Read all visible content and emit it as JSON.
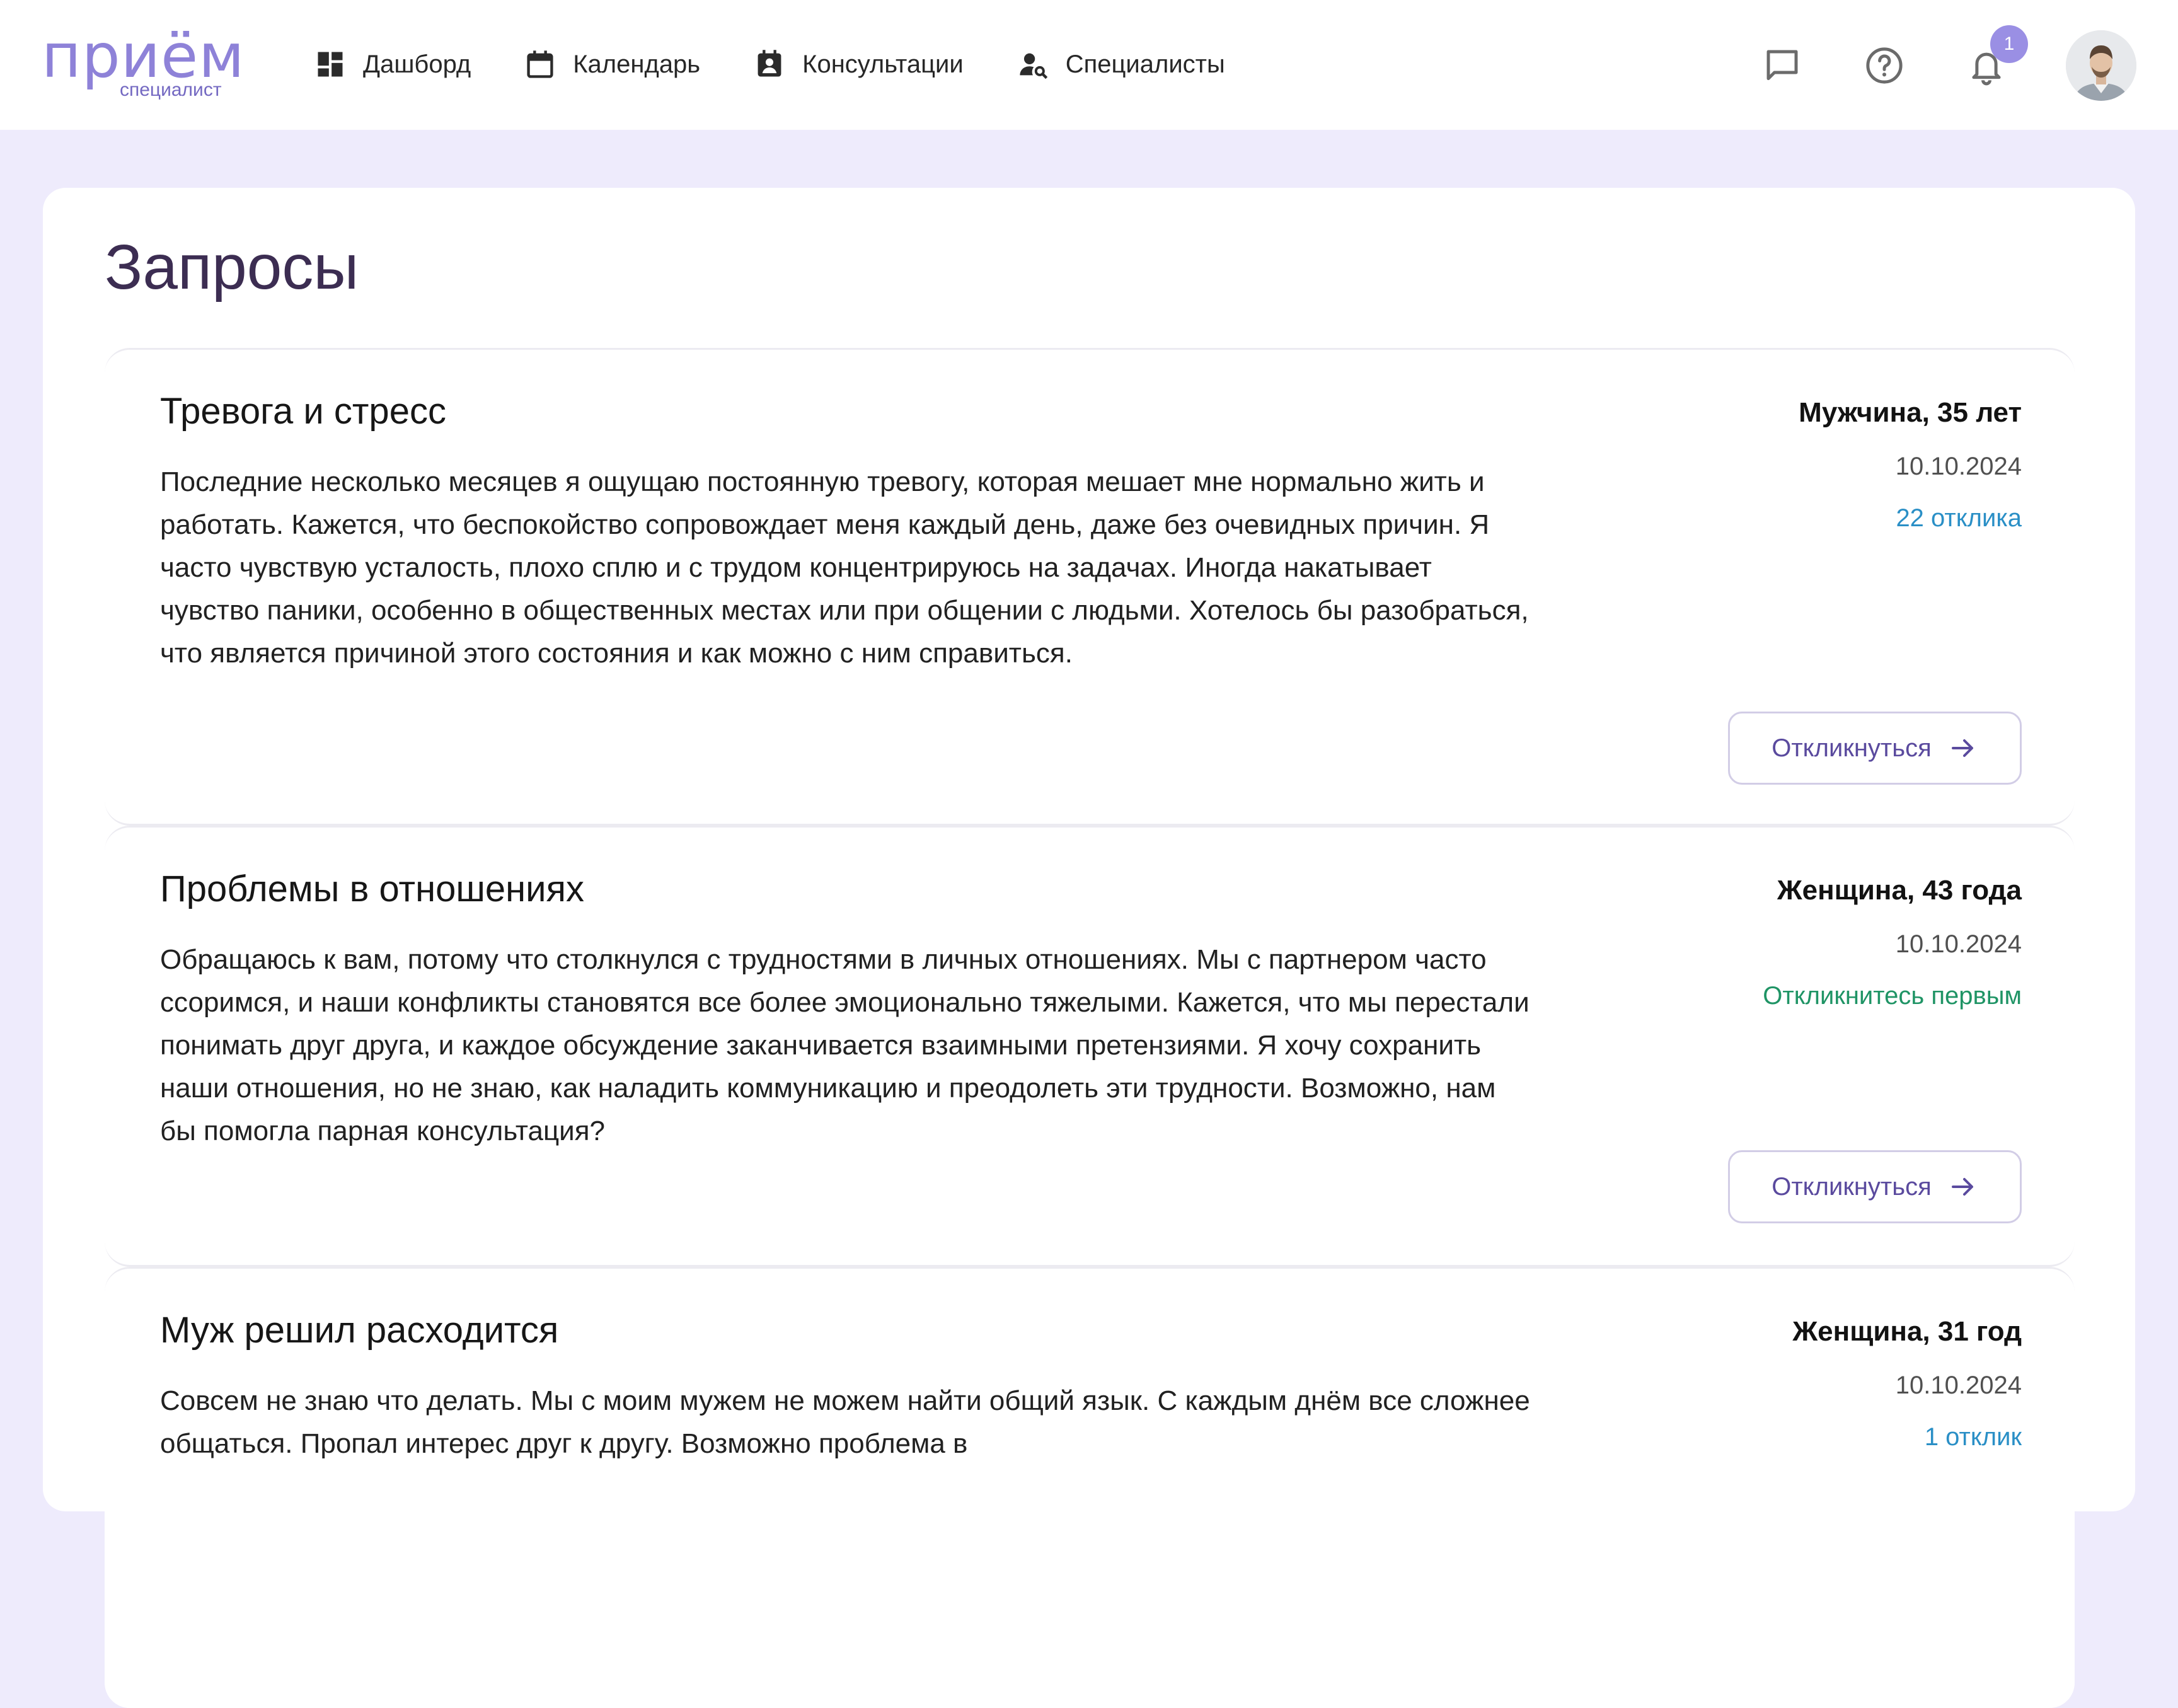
{
  "brand": {
    "logo_main": "приём",
    "logo_sub": "специалист"
  },
  "nav": {
    "items": [
      {
        "label": "Дашборд",
        "icon": "dashboard-icon"
      },
      {
        "label": "Календарь",
        "icon": "calendar-icon"
      },
      {
        "label": "Консультации",
        "icon": "consultations-icon"
      },
      {
        "label": "Специалисты",
        "icon": "specialists-icon"
      }
    ]
  },
  "header": {
    "notifications_count": "1",
    "icons": [
      "chat-icon",
      "help-icon",
      "bell-icon"
    ]
  },
  "page": {
    "title": "Запросы"
  },
  "requests": [
    {
      "title": "Тревога и стресс",
      "text": "Последние несколько месяцев я ощущаю постоянную тревогу, которая мешает мне нормально жить и работать. Кажется, что беспокойство сопровождает меня каждый день, даже без очевидных причин. Я часто чувствую усталость, плохо сплю и с трудом концентрируюсь на задачах. Иногда накатывает чувство паники, особенно в общественных местах или при общении с людьми. Хотелось бы разобраться, что является причиной этого состояния и как можно с ним справиться.",
      "who": "Мужчина, 35 лет",
      "date": "10.10.2024",
      "responses": "22 отклика",
      "responses_color": "#2a8fc6",
      "button": "Откликнуться"
    },
    {
      "title": "Проблемы в отношениях",
      "text": "Обращаюсь к вам, потому что столкнулся с трудностями в личных отношениях. Мы с партнером часто ссоримся, и наши конфликты становятся все более эмоционально тяжелыми. Кажется, что мы перестали понимать друг друга, и каждое обсуждение заканчивается взаимными претензиями. Я хочу сохранить наши отношения, но не знаю, как наладить коммуникацию и преодолеть эти трудности. Возможно, нам бы помогла парная консультация?",
      "who": "Женщина, 43 года",
      "date": "10.10.2024",
      "responses": "Откликнитесь первым",
      "responses_color": "#1f9465",
      "button": "Откликнуться"
    },
    {
      "title": "Муж решил расходится",
      "text": "Совсем не знаю что делать. Мы с моим мужем не можем найти общий язык. С каждым днём все сложнее общаться. Пропал интерес друг к другу. Возможно проблема в",
      "who": "Женщина, 31 год",
      "date": "10.10.2024",
      "responses": "1 отклик",
      "responses_color": "#2a8fc6"
    }
  ],
  "colors": {
    "accent": "#8e82d8",
    "background": "#eeebfc",
    "button_text": "#5a4a9e"
  }
}
